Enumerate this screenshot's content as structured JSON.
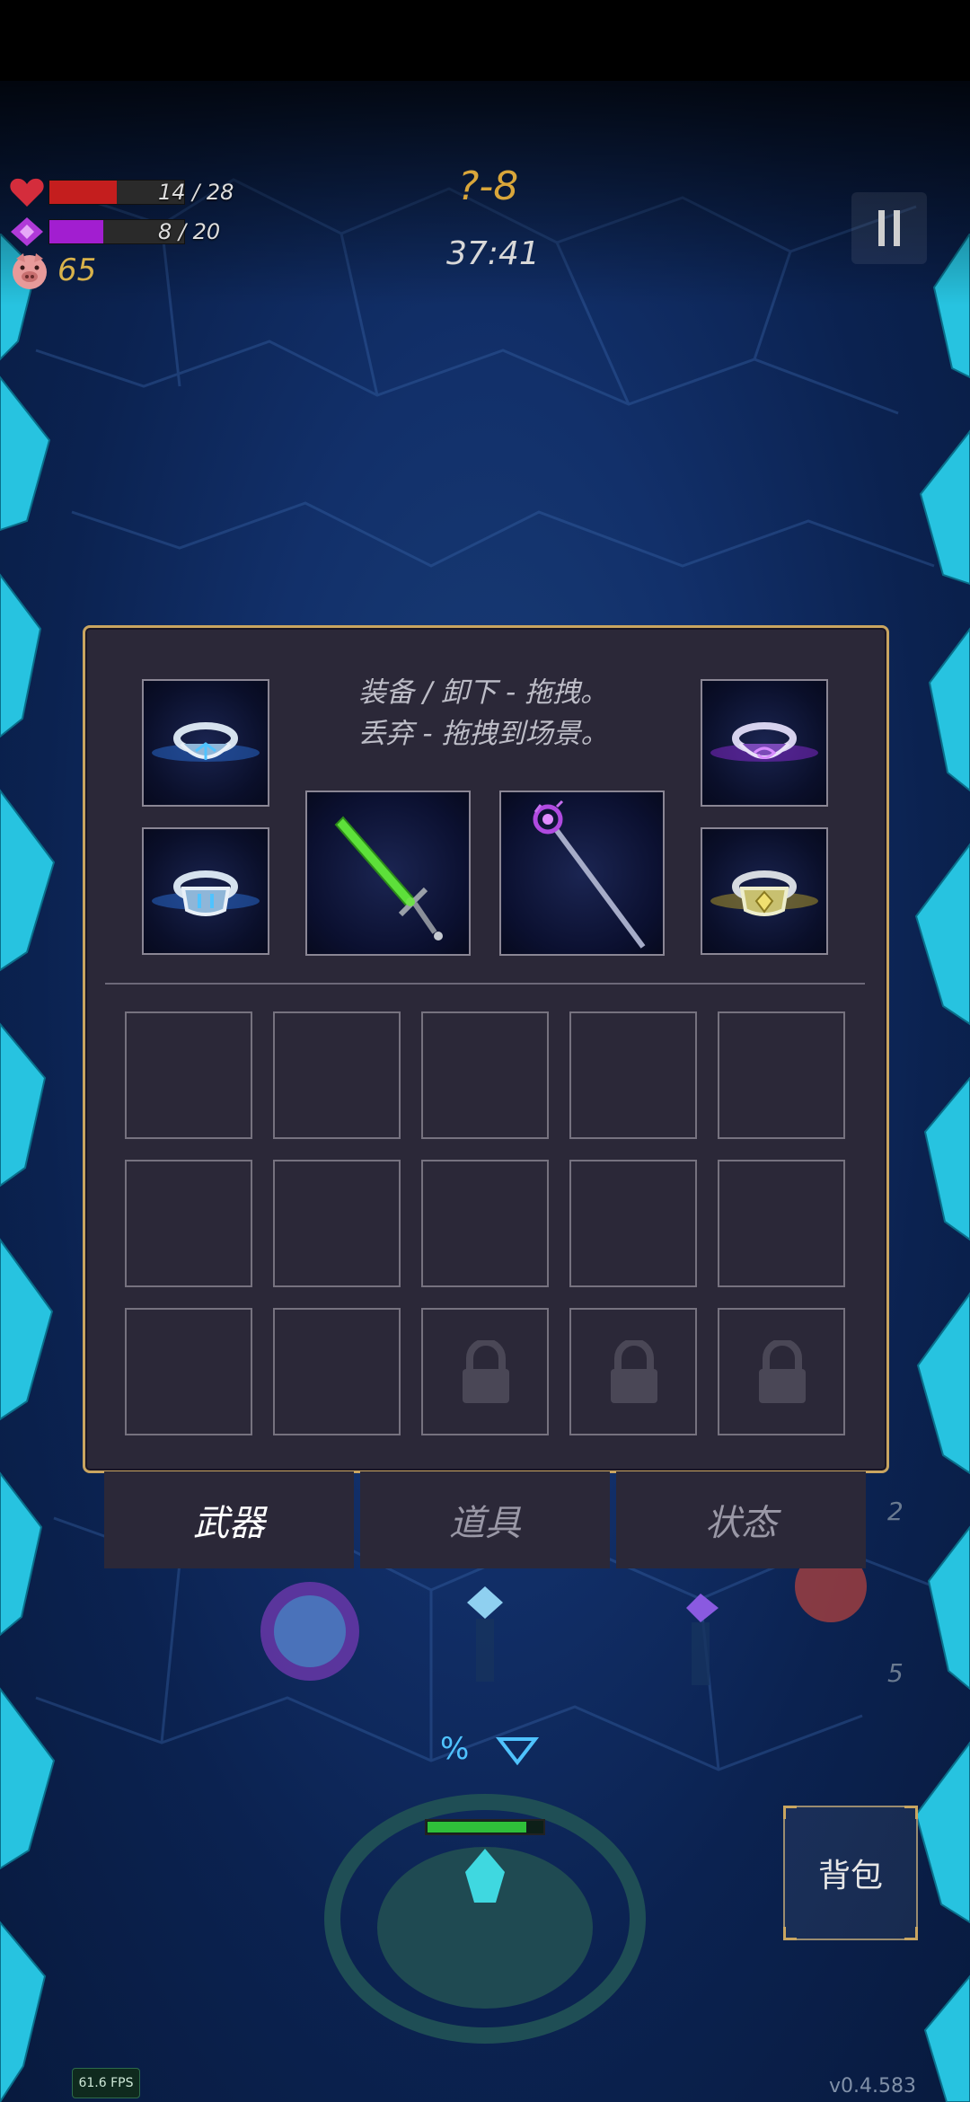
{
  "hud": {
    "health": {
      "current": 14,
      "max": 28,
      "text": "14 / 28",
      "color": "#c41e1e"
    },
    "mana": {
      "current": 8,
      "max": 20,
      "text": "8 / 20",
      "color": "#a21ed0"
    },
    "gold": "65",
    "level": "?-8",
    "timer": "37:41"
  },
  "inventory": {
    "hint_line1": "装备 / 卸下 - 拖拽。",
    "hint_line2": "丢弃 - 拖拽到场景。",
    "equipped": [
      {
        "slot": "ring-top-left",
        "item": "blue-rune-ring-icon"
      },
      {
        "slot": "ring-bottom-left",
        "item": "blue-shield-ring-icon"
      },
      {
        "slot": "weapon-1",
        "item": "green-sword-icon"
      },
      {
        "slot": "weapon-2",
        "item": "purple-staff-icon"
      },
      {
        "slot": "ring-top-right",
        "item": "purple-swirl-ring-icon"
      },
      {
        "slot": "ring-bottom-right",
        "item": "gold-gem-ring-icon"
      }
    ],
    "grid_rows": 3,
    "grid_cols": 5,
    "locked_slots": 3
  },
  "tabs": [
    {
      "label": "武器",
      "active": true
    },
    {
      "label": "道具",
      "active": false
    },
    {
      "label": "状态",
      "active": false
    }
  ],
  "bottom": {
    "bag_label": "背包",
    "fps": "61.6 FPS",
    "version": "v0.4.583",
    "side_number_top": "2",
    "side_number_bottom": "5"
  },
  "colors": {
    "panel_bg": "#2b2838",
    "panel_border": "#c9a560",
    "level_text": "#d9a63a",
    "gold_text": "#d9b24a"
  }
}
